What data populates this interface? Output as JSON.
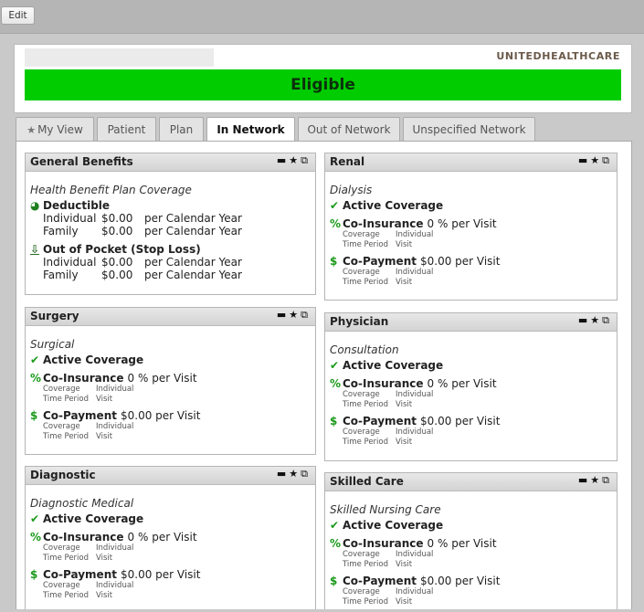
{
  "toolbar": {
    "edit_label": "Edit"
  },
  "header": {
    "payer": "UNITEDHEALTHCARE",
    "status": "Eligible"
  },
  "tabs": [
    {
      "label": "My View",
      "icon": "star-icon"
    },
    {
      "label": "Patient"
    },
    {
      "label": "Plan"
    },
    {
      "label": "In Network",
      "active": true
    },
    {
      "label": "Out of Network"
    },
    {
      "label": "Unspecified Network"
    }
  ],
  "panels": {
    "general": {
      "title": "General Benefits",
      "coverage": "Health Benefit Plan Coverage",
      "deductible": {
        "label": "Deductible",
        "rows": [
          {
            "who": "Individual",
            "amount": "$0.00",
            "period": "per Calendar Year"
          },
          {
            "who": "Family",
            "amount": "$0.00",
            "period": "per Calendar Year"
          }
        ]
      },
      "oop": {
        "label": "Out of Pocket (Stop Loss)",
        "rows": [
          {
            "who": "Individual",
            "amount": "$0.00",
            "period": "per Calendar Year"
          },
          {
            "who": "Family",
            "amount": "$0.00",
            "period": "per Calendar Year"
          }
        ]
      }
    },
    "surgery": {
      "title": "Surgery",
      "coverage": "Surgical",
      "active": "Active Coverage",
      "coins_label": "Co-Insurance",
      "coins_value": "0 % per Visit",
      "copay_label": "Co-Payment",
      "copay_value": "$0.00 per Visit",
      "k1": "Coverage",
      "v1": "Individual",
      "k2": "Time Period",
      "v2": "Visit"
    },
    "diagnostic": {
      "title": "Diagnostic",
      "coverage": "Diagnostic Medical",
      "active": "Active Coverage",
      "coins_label": "Co-Insurance",
      "coins_value": "0 % per Visit",
      "copay_label": "Co-Payment",
      "copay_value": "$0.00 per Visit",
      "k1": "Coverage",
      "v1": "Individual",
      "k2": "Time Period",
      "v2": "Visit"
    },
    "renal": {
      "title": "Renal",
      "coverage": "Dialysis",
      "active": "Active Coverage",
      "coins_label": "Co-Insurance",
      "coins_value": "0 % per Visit",
      "copay_label": "Co-Payment",
      "copay_value": "$0.00 per Visit",
      "k1": "Coverage",
      "v1": "Individual",
      "k2": "Time Period",
      "v2": "Visit"
    },
    "physician": {
      "title": "Physician",
      "coverage": "Consultation",
      "active": "Active Coverage",
      "coins_label": "Co-Insurance",
      "coins_value": "0 % per Visit",
      "copay_label": "Co-Payment",
      "copay_value": "$0.00 per Visit",
      "k1": "Coverage",
      "v1": "Individual",
      "k2": "Time Period",
      "v2": "Visit"
    },
    "skilled": {
      "title": "Skilled Care",
      "coverage": "Skilled Nursing Care",
      "active": "Active Coverage",
      "coins_label": "Co-Insurance",
      "coins_value": "0 % per Visit",
      "copay_label": "Co-Payment",
      "copay_value": "$0.00 per Visit",
      "k1": "Coverage",
      "v1": "Individual",
      "k2": "Time Period",
      "v2": "Visit"
    }
  },
  "colors": {
    "eligible": "#00cc00",
    "icon_green": "#1a9a1a"
  }
}
